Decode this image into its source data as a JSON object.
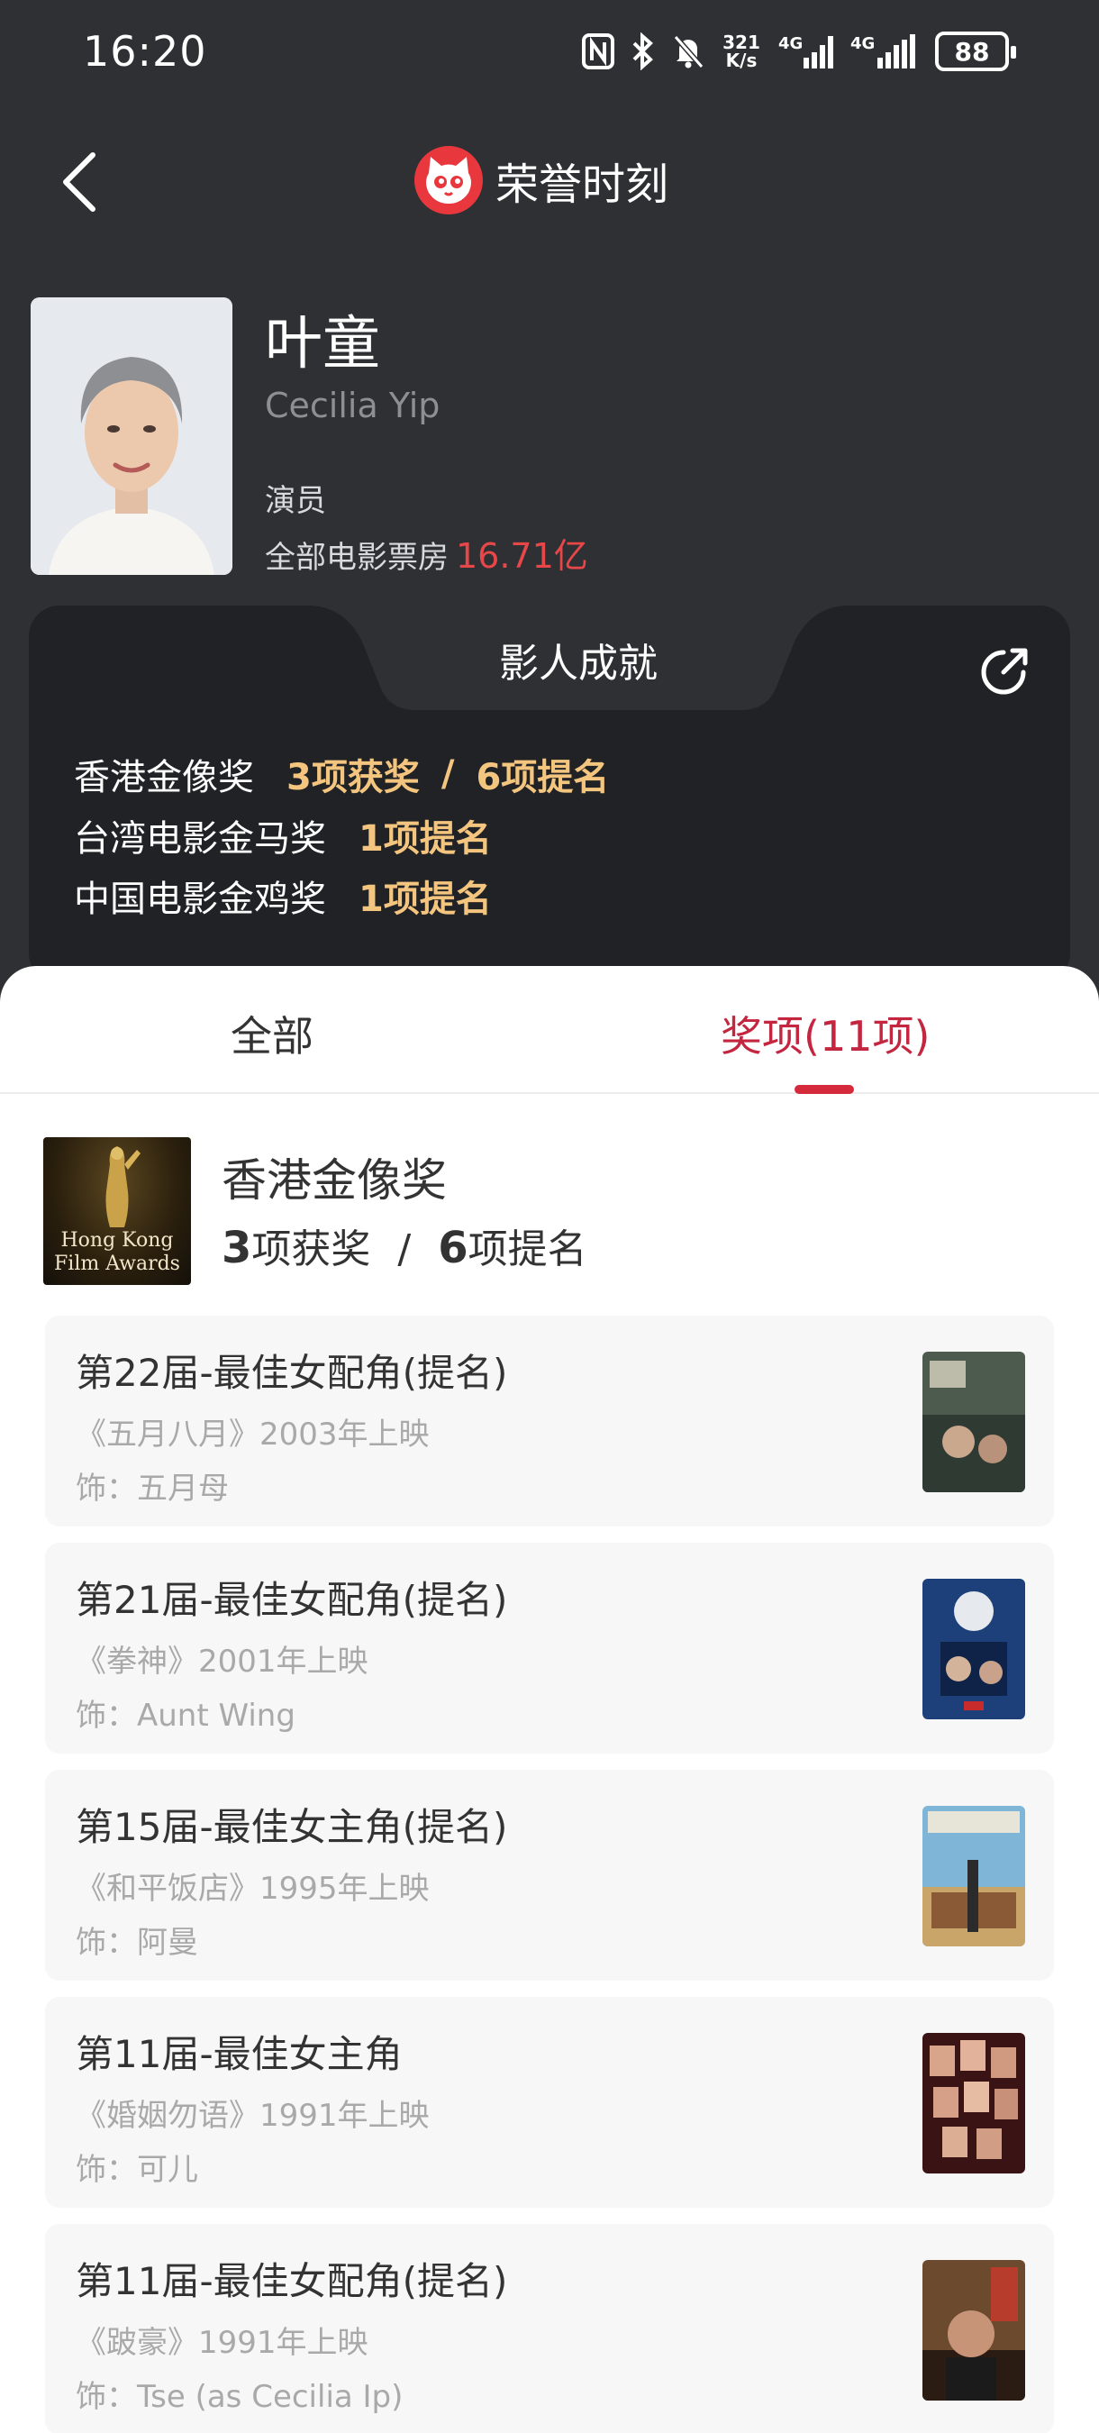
{
  "status_bar": {
    "time": "16:20",
    "net_speed_top": "321",
    "net_speed_unit": "K/s",
    "signal1": "4G",
    "signal2": "4G",
    "battery": "88"
  },
  "header": {
    "title": "荣誉时刻",
    "logo_icon": "maoyan-cat-icon"
  },
  "profile": {
    "name_cn": "叶童",
    "name_en": "Cecilia Yip",
    "role": "演员",
    "boxoffice_label": "全部电影票房",
    "boxoffice_value": "16.71亿"
  },
  "achievements": {
    "title": "影人成就",
    "rows": [
      {
        "award": "香港金像奖",
        "wins": "3项获奖",
        "slash": "/",
        "noms": "6项提名"
      },
      {
        "award": "台湾电影金马奖",
        "noms": "1项提名"
      },
      {
        "award": "中国电影金鸡奖",
        "noms": "1项提名"
      }
    ]
  },
  "tabs": {
    "all": "全部",
    "awards": "奖项(11项)"
  },
  "award_section": {
    "name": "香港金像奖",
    "wins_num": "3",
    "wins_label": "项获奖",
    "slash": "/",
    "noms_num": "6",
    "noms_label": "项提名",
    "logo_text_1": "Hong Kong",
    "logo_text_2": "Film Awards"
  },
  "items": [
    {
      "title": "第22届-最佳女配角(提名)",
      "film": "《五月八月》2003年上映",
      "role": "饰：五月母"
    },
    {
      "title": "第21届-最佳女配角(提名)",
      "film": "《拳神》2001年上映",
      "role": "饰：Aunt Wing"
    },
    {
      "title": "第15届-最佳女主角(提名)",
      "film": "《和平饭店》1995年上映",
      "role": "饰：阿曼"
    },
    {
      "title": "第11届-最佳女主角",
      "film": "《婚姻勿语》1991年上映",
      "role": "饰：可儿"
    },
    {
      "title": "第11届-最佳女配角(提名)",
      "film": "《跛豪》1991年上映",
      "role": "饰：Tse (as Cecilia Ip)"
    }
  ],
  "colors": {
    "accent": "#d42a3c",
    "boxoffice": "#e8474a",
    "gold": "#f4c57f",
    "background": "#2f3033"
  }
}
